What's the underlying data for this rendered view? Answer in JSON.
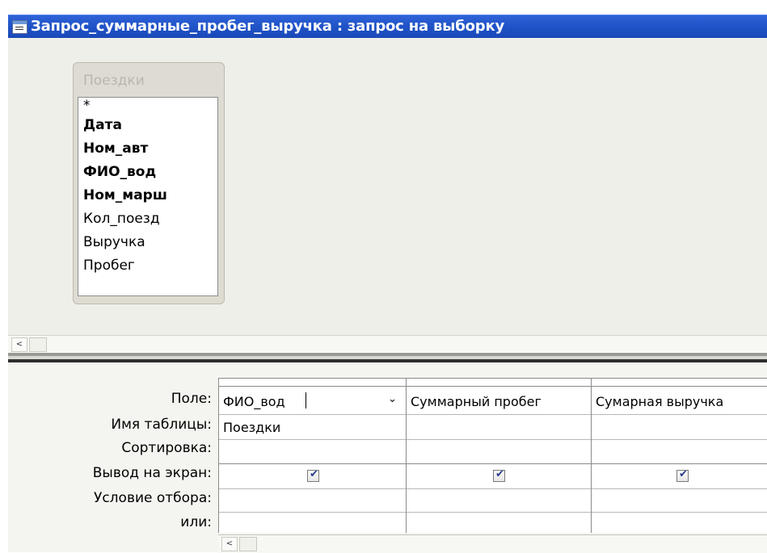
{
  "window": {
    "title": "Запрос_суммарные_пробег_выручка : запрос на выборку",
    "icon": "query-table-icon"
  },
  "table_list": {
    "title": "Поездки",
    "fields": [
      {
        "name": "*",
        "bold": false
      },
      {
        "name": "Дата",
        "bold": true
      },
      {
        "name": "Ном_авт",
        "bold": true
      },
      {
        "name": "ФИО_вод",
        "bold": true
      },
      {
        "name": "Ном_марш",
        "bold": true
      },
      {
        "name": "Кол_поезд",
        "bold": false
      },
      {
        "name": "Выручка",
        "bold": false
      },
      {
        "name": "Пробег",
        "bold": false
      }
    ]
  },
  "scroll": {
    "left_arrow": "<"
  },
  "grid": {
    "row_labels": {
      "field": "Поле:",
      "table": "Имя таблицы:",
      "sort": "Сортировка:",
      "show": "Вывод на экран:",
      "criteria": "Условие отбора:",
      "or": "или:"
    },
    "columns": [
      {
        "field": "ФИО_вод",
        "table": "Поездки",
        "sort": "",
        "show": true,
        "criteria": "",
        "or": ""
      },
      {
        "field": "Суммарный пробег",
        "table": "",
        "sort": "",
        "show": true,
        "criteria": "",
        "or": ""
      },
      {
        "field": "Сумарная выручка",
        "table": "",
        "sort": "",
        "show": true,
        "criteria": "",
        "or": ""
      }
    ],
    "check_glyph": "✔",
    "dropdown_glyph": "⌄"
  },
  "colors": {
    "title_bar": "#2154c8",
    "upper_pane": "#efefe9",
    "grid_bg": "#ffffff"
  }
}
